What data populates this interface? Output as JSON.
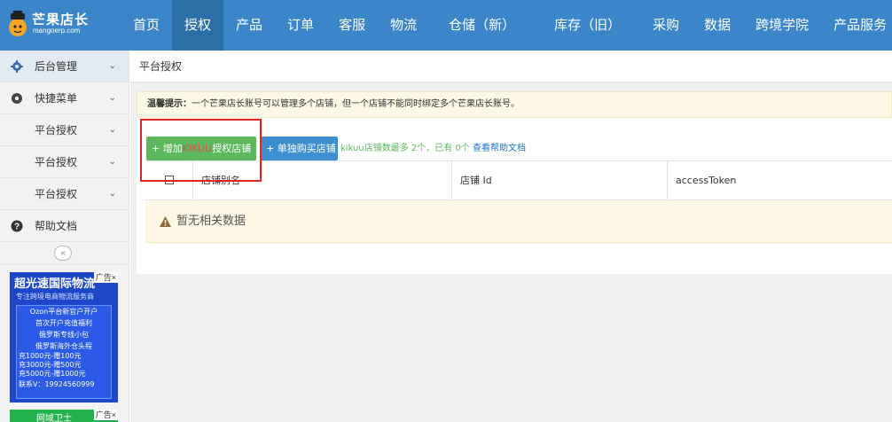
{
  "app": {
    "logo_name": "芒果店长",
    "logo_sub": "mangoerp.com"
  },
  "nav": {
    "items": [
      {
        "label": "首页"
      },
      {
        "label": "授权",
        "active": true
      },
      {
        "label": "产品"
      },
      {
        "label": "订单"
      },
      {
        "label": "客服"
      },
      {
        "label": "物流"
      },
      {
        "label": "仓储（新）"
      },
      {
        "label": "库存（旧）"
      },
      {
        "label": "采购"
      },
      {
        "label": "数据"
      },
      {
        "label": "跨境学院"
      },
      {
        "label": "产品服务"
      }
    ]
  },
  "sidebar": {
    "items": [
      {
        "label": "后台管理",
        "icon": "gear-icon"
      },
      {
        "label": "快捷菜单",
        "icon": "gear-icon"
      },
      {
        "label": "平台授权"
      },
      {
        "label": "平台授权"
      },
      {
        "label": "平台授权"
      },
      {
        "label": "帮助文档",
        "icon": "help-circle-icon"
      }
    ],
    "collapse_glyph": "«",
    "ad1": {
      "title": "超光速国际物流",
      "subtitle": "专注跨境电商物流服务商",
      "lines": [
        "Ozon平台新官户开户",
        "首次开户充值福利",
        "俄罗斯专线小包",
        "俄罗斯海外仓头程"
      ],
      "offers": [
        "充1000元-赠100元",
        "充3000元-赠500元",
        "充5000元-赠1000元"
      ],
      "contact": "联系V：19924560999",
      "tag": "广告×"
    },
    "ad2": {
      "text": "网域卫士",
      "tag": "广告×"
    }
  },
  "main": {
    "breadcrumb": "平台授权",
    "tip_label": "温馨提示：",
    "tip_text": "一个芒果店长账号可以管理多个店铺，但一个店铺不能同时绑定多个芒果店长账号。",
    "add_button": {
      "prefix": "+ 增加",
      "highlight": "KIKUU",
      "suffix": "授权店铺"
    },
    "buy_button": "+ 单独购买店铺",
    "info_text": "kikuu店铺数最多 2个，已有 0个",
    "help_link": "查看帮助文档",
    "table": {
      "columns": [
        "店铺别名",
        "店铺 Id",
        "accessToken"
      ],
      "empty_text": "暂无相关数据"
    }
  },
  "colors": {
    "topbar": "#3a86c8",
    "nav_active": "#2b6fa8",
    "green": "#5cb85c",
    "blue": "#3e8fd0",
    "highlight_red": "#e02424",
    "tip_bg": "#fcf8e3"
  }
}
